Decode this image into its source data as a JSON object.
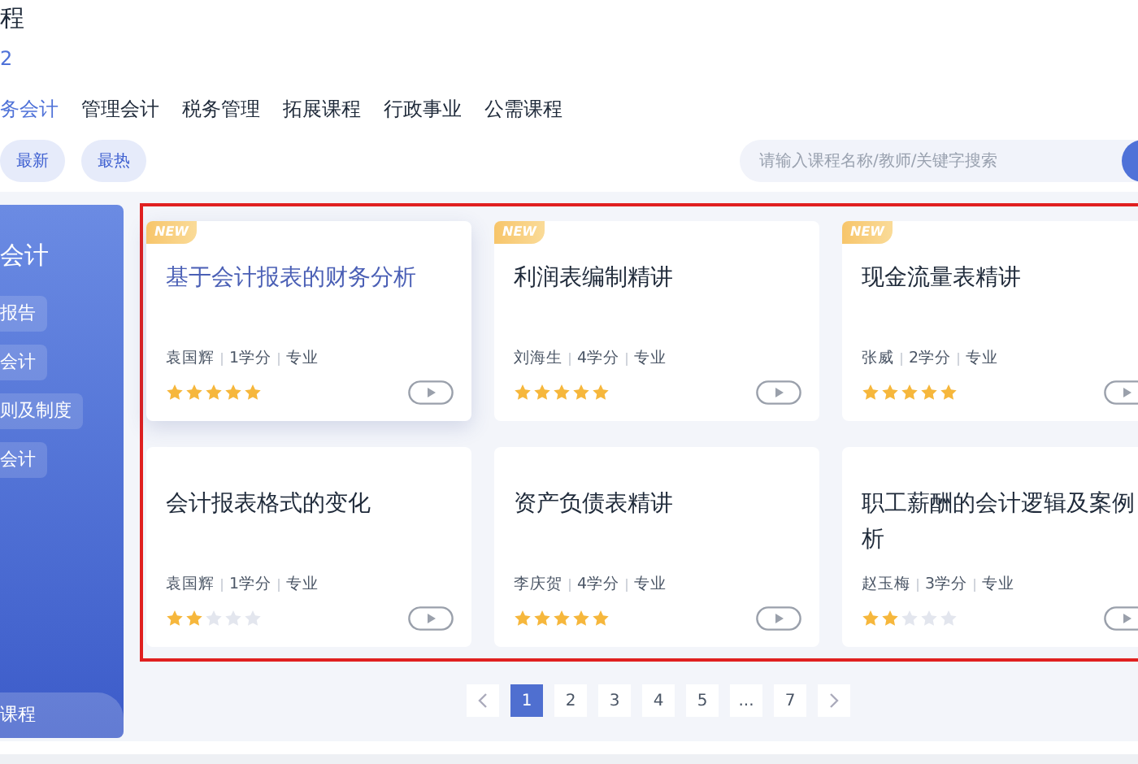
{
  "header": {
    "title": "程",
    "count": "2"
  },
  "tabs": [
    {
      "label": "务会计",
      "selected": true
    },
    {
      "label": "管理会计",
      "selected": false
    },
    {
      "label": "税务管理",
      "selected": false
    },
    {
      "label": "拓展课程",
      "selected": false
    },
    {
      "label": "行政事业",
      "selected": false
    },
    {
      "label": "公需课程",
      "selected": false
    }
  ],
  "sort_buttons": [
    "最新",
    "最热"
  ],
  "search": {
    "placeholder": "请输入课程名称/教师/关键字搜索"
  },
  "sidebar": {
    "title": "会计",
    "items": [
      "报告",
      "会计",
      "则及制度",
      "会计"
    ],
    "footer": "课程"
  },
  "courses": [
    {
      "title": "基于会计报表的财务分析",
      "teacher": "袁国辉",
      "credits": "1学分",
      "type": "专业",
      "stars": 5,
      "badge": "NEW",
      "selected": true
    },
    {
      "title": "利润表编制精讲",
      "teacher": "刘海生",
      "credits": "4学分",
      "type": "专业",
      "stars": 5,
      "badge": "NEW",
      "selected": false
    },
    {
      "title": "现金流量表精讲",
      "teacher": "张威",
      "credits": "2学分",
      "type": "专业",
      "stars": 5,
      "badge": "NEW",
      "selected": false
    },
    {
      "title": "会计报表格式的变化",
      "teacher": "袁国辉",
      "credits": "1学分",
      "type": "专业",
      "stars": 2,
      "selected": false
    },
    {
      "title": "资产负债表精讲",
      "teacher": "李庆贺",
      "credits": "4学分",
      "type": "专业",
      "stars": 5,
      "selected": false
    },
    {
      "title_lines": [
        "职工薪酬的会计逻辑及案例",
        "析"
      ],
      "teacher": "赵玉梅",
      "credits": "3学分",
      "type": "专业",
      "stars": 2,
      "selected": false
    }
  ],
  "pagination": {
    "pages": [
      {
        "label": "1",
        "selected": true
      },
      {
        "label": "2",
        "selected": false
      },
      {
        "label": "3",
        "selected": false
      },
      {
        "label": "4",
        "selected": false
      },
      {
        "label": "5",
        "selected": false
      },
      {
        "label": "...",
        "selected": false
      },
      {
        "label": "7",
        "selected": false
      }
    ]
  }
}
